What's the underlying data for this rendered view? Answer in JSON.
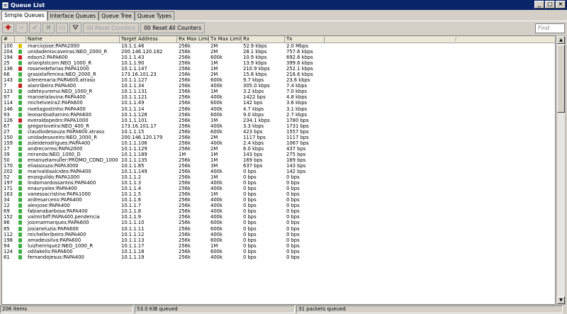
{
  "window": {
    "title": "Queue List",
    "controls": [
      "_",
      "□",
      "×"
    ]
  },
  "tabs": [
    {
      "label": "Simple Queues",
      "active": true
    },
    {
      "label": "Interface Queues",
      "active": false
    },
    {
      "label": "Queue Tree",
      "active": false
    },
    {
      "label": "Queue Types",
      "active": false
    }
  ],
  "toolbar": {
    "reset_counters": "Reset Counters",
    "reset_all_counters": "Reset All Counters",
    "find_placeholder": "Find",
    "reset_counters_prefix": "00",
    "reset_all_prefix": "00"
  },
  "columns": [
    "#",
    "",
    "Name",
    "Target Address",
    "Rx Max Limit",
    "Tx Max Limit",
    "Rx",
    "Tx",
    "/"
  ],
  "rows": [
    {
      "num": "100",
      "status": "y",
      "name": "marciojose:PAPA2000",
      "target": "10.1.1.46",
      "rx_max": "256k",
      "tx_max": "2M",
      "rx": "52.9 kbps",
      "tx": "2.0 Mbps"
    },
    {
      "num": "204",
      "status": "g",
      "name": "unidadeniocaveiras:NEO_2000_R",
      "target": "200.146.120.182",
      "rx_max": "256k",
      "tx_max": "2M",
      "rx": "28.1 kbps",
      "tx": "757.6 kbps"
    },
    {
      "num": "194",
      "status": "r",
      "name": "edson2:PAPA600",
      "target": "10.1.1.43",
      "rx_max": "256k",
      "tx_max": "600k",
      "rx": "10.9 kbps",
      "tx": "692.6 kbps"
    },
    {
      "num": "25",
      "status": "g",
      "name": "arlanplstcom:NEO_1000_R",
      "target": "10.1.1.90",
      "rx_max": "256k",
      "tx_max": "1M",
      "rx": "13.9 kbps",
      "tx": "399.6 kbps"
    },
    {
      "num": "136",
      "status": "r",
      "name": "rosanedefarias:PAPA1000",
      "target": "10.1.1.147",
      "rx_max": "256k",
      "tx_max": "1M",
      "rx": "210.9 kbps",
      "tx": "252.1 kbps"
    },
    {
      "num": "66",
      "status": "g",
      "name": "grasielafirmina:NEO_2000_R",
      "target": "173.16.101.23",
      "rx_max": "256k",
      "tx_max": "2M",
      "rx": "15.8 kbps",
      "tx": "216.6 kbps"
    },
    {
      "num": "143",
      "status": "g",
      "name": "silenemaria:PAPA600.atraso",
      "target": "10.1.1.127",
      "rx_max": "256k",
      "tx_max": "600k",
      "rx": "9.7 kbps",
      "tx": "23.6 kbps"
    },
    {
      "num": "7",
      "status": "r",
      "name": "alanribeiro:PAPA400",
      "target": "10.1.1.34",
      "rx_max": "256k",
      "tx_max": "400k",
      "rx": "305.0 kbps",
      "tx": "7.4 kbps"
    },
    {
      "num": "123",
      "status": "g",
      "name": "odeteyurema:NEO_1000_R",
      "target": "10.1.1.131",
      "rx_max": "256k",
      "tx_max": "1M",
      "rx": "3.2 kbps",
      "tx": "7.0 kbps"
    },
    {
      "num": "97",
      "status": "g",
      "name": "manoelalavina:PAPA400",
      "target": "10.1.1.121",
      "rx_max": "256k",
      "tx_max": "400k",
      "rx": "1422 bps",
      "tx": "4.8 kbps"
    },
    {
      "num": "114",
      "status": "g",
      "name": "michelvieira2:PAPA600",
      "target": "10.1.1.49",
      "rx_max": "256k",
      "tx_max": "600k",
      "rx": "142 bps",
      "tx": "3.6 kbps"
    },
    {
      "num": "146",
      "status": "g",
      "name": "noeliagostinho:PAPA400",
      "target": "10.1.1.14",
      "rx_max": "256k",
      "tx_max": "400k",
      "rx": "4.7 kbps",
      "tx": "3.1 kbps"
    },
    {
      "num": "93",
      "status": "g",
      "name": "leonardoaltamiro:PAPA600",
      "target": "10.1.1.128",
      "rx_max": "256k",
      "tx_max": "600k",
      "rx": "9.0 kbps",
      "tx": "2.7 kbps"
    },
    {
      "num": "126",
      "status": "r",
      "name": "everaldopedro:PAPA1000",
      "target": "10.1.1.101",
      "rx_max": "256k",
      "tx_max": "1M",
      "rx": "234.1 kbps",
      "tx": "1780 bps"
    },
    {
      "num": "67",
      "status": "g",
      "name": "gregorioveira:NEO_400_R",
      "target": "173.16.101.17",
      "rx_max": "256k",
      "tx_max": "400k",
      "rx": "3.3 kbps",
      "tx": "1731 bps"
    },
    {
      "num": "27",
      "status": "g",
      "name": "claudiodesouza:PAPA600.atraso",
      "target": "10.1.1.15",
      "rx_max": "256k",
      "tx_max": "600k",
      "rx": "423 bps",
      "tx": "1557 bps"
    },
    {
      "num": "150",
      "status": "g",
      "name": "unidadesaveiro:NEO_2000_R",
      "target": "200.146.120.179",
      "rx_max": "256k",
      "tx_max": "2M",
      "rx": "1117 bps",
      "tx": "1117 bps"
    },
    {
      "num": "159",
      "status": "g",
      "name": "zuleiderodrigues:PAPA400",
      "target": "10.1.1.106",
      "rx_max": "256k",
      "tx_max": "400k",
      "rx": "2.4 kbps",
      "tx": "1067 bps"
    },
    {
      "num": "17",
      "status": "g",
      "name": "andrecorrea:PAPA2000",
      "target": "10.1.1.129",
      "rx_max": "256k",
      "tx_max": "2M",
      "rx": "6.0 kbps",
      "tx": "437 bps"
    },
    {
      "num": "39",
      "status": "g",
      "name": "miranda:NEO_1000_D",
      "target": "10.1.1.189",
      "rx_max": "1M",
      "tx_max": "1M",
      "rx": "143 bps",
      "tx": "275 bps"
    },
    {
      "num": "50",
      "status": "g",
      "name": "emanuelamuller:PROMO_COND_1000",
      "target": "10.1.1.135",
      "rx_max": "256k",
      "tx_max": "1M",
      "rx": "169 bps",
      "tx": "169 bps"
    },
    {
      "num": "170",
      "status": "g",
      "name": "eliassouza:PAPA3000",
      "target": "10.1.1.85",
      "rx_max": "256k",
      "tx_max": "3M",
      "rx": "637 bps",
      "tx": "143 bps"
    },
    {
      "num": "202",
      "status": "g",
      "name": "marivaldaalcides:PAPA400",
      "target": "10.1.1.149",
      "rx_max": "256k",
      "tx_max": "400k",
      "rx": "0 bps",
      "tx": "142 bps"
    },
    {
      "num": "52",
      "status": "g",
      "name": "enzoguildo:PAPA1000",
      "target": "10.1.1.2",
      "rx_max": "256k",
      "tx_max": "1M",
      "rx": "0 bps",
      "tx": "0 bps"
    },
    {
      "num": "197",
      "status": "g",
      "name": "lindomardossantos:PAPA400",
      "target": "10.1.1.3",
      "rx_max": "256k",
      "tx_max": "400k",
      "rx": "0 bps",
      "tx": "0 bps"
    },
    {
      "num": "171",
      "status": "g",
      "name": "enauryalex:PAPA400",
      "target": "10.1.1.4",
      "rx_max": "256k",
      "tx_max": "400k",
      "rx": "0 bps",
      "tx": "0 bps"
    },
    {
      "num": "163",
      "status": "g",
      "name": "vanessacristina:PAPA1000",
      "target": "10.1.1.5",
      "rx_max": "256k",
      "tx_max": "1M",
      "rx": "0 bps",
      "tx": "0 bps"
    },
    {
      "num": "34",
      "status": "g",
      "name": "ardresarceno:PAPA400",
      "target": "10.1.1.6",
      "rx_max": "256k",
      "tx_max": "400k",
      "rx": "0 bps",
      "tx": "0 bps"
    },
    {
      "num": "12",
      "status": "g",
      "name": "alexjose:PAPA400",
      "target": "10.1.1.7",
      "rx_max": "256k",
      "tx_max": "400k",
      "rx": "0 bps",
      "tx": "0 bps"
    },
    {
      "num": "69",
      "status": "g",
      "name": "fabianabarbosa:PAPA400",
      "target": "10.1.1.8",
      "rx_max": "256k",
      "tx_max": "400k",
      "rx": "0 bps",
      "tx": "0 bps"
    },
    {
      "num": "152",
      "status": "g",
      "name": "valmirbiff:PAPA400.pendencia",
      "target": "10.1.1.9",
      "rx_max": "256k",
      "tx_max": "400k",
      "rx": "0 bps",
      "tx": "0 bps"
    },
    {
      "num": "86",
      "status": "g",
      "name": "josimarmarques:PAPA600",
      "target": "10.1.1.10",
      "rx_max": "256k",
      "tx_max": "600k",
      "rx": "0 bps",
      "tx": "0 bps"
    },
    {
      "num": "85",
      "status": "g",
      "name": "josianeluzia:PAPA600",
      "target": "10.1.1.11",
      "rx_max": "256k",
      "tx_max": "600k",
      "rx": "0 bps",
      "tx": "0 bps"
    },
    {
      "num": "112",
      "status": "g",
      "name": "michelleribeiro:PAPA400",
      "target": "10.1.1.12",
      "rx_max": "256k",
      "tx_max": "400k",
      "rx": "0 bps",
      "tx": "0 bps"
    },
    {
      "num": "198",
      "status": "g",
      "name": "amadeusilva:PAPA600",
      "target": "10.1.1.13",
      "rx_max": "256k",
      "tx_max": "600k",
      "rx": "0 bps",
      "tx": "0 bps"
    },
    {
      "num": "94",
      "status": "g",
      "name": "luizhenrique2:NEO_1000_R",
      "target": "10.1.1.17",
      "rx_max": "256k",
      "tx_max": "1M",
      "rx": "0 bps",
      "tx": "0 bps"
    },
    {
      "num": "124",
      "status": "g",
      "name": "odilakelis:PAPA600",
      "target": "10.1.1.18",
      "rx_max": "256k",
      "tx_max": "600k",
      "rx": "0 bps",
      "tx": "0 bps"
    },
    {
      "num": "61",
      "status": "g",
      "name": "fernandojesus:PAPA400",
      "target": "10.1.1.19",
      "rx_max": "256k",
      "tx_max": "400k",
      "rx": "0 bps",
      "tx": "0 bps"
    }
  ],
  "status_bar": {
    "items": "206 items",
    "queued_bytes": "53.0 KiB queued",
    "queued_packets": "31 packets queued"
  },
  "colors": {
    "title_bg": "#0a246a",
    "status_green": "#3cb043",
    "status_red": "#c82020",
    "status_yellow": "#e0c000"
  }
}
